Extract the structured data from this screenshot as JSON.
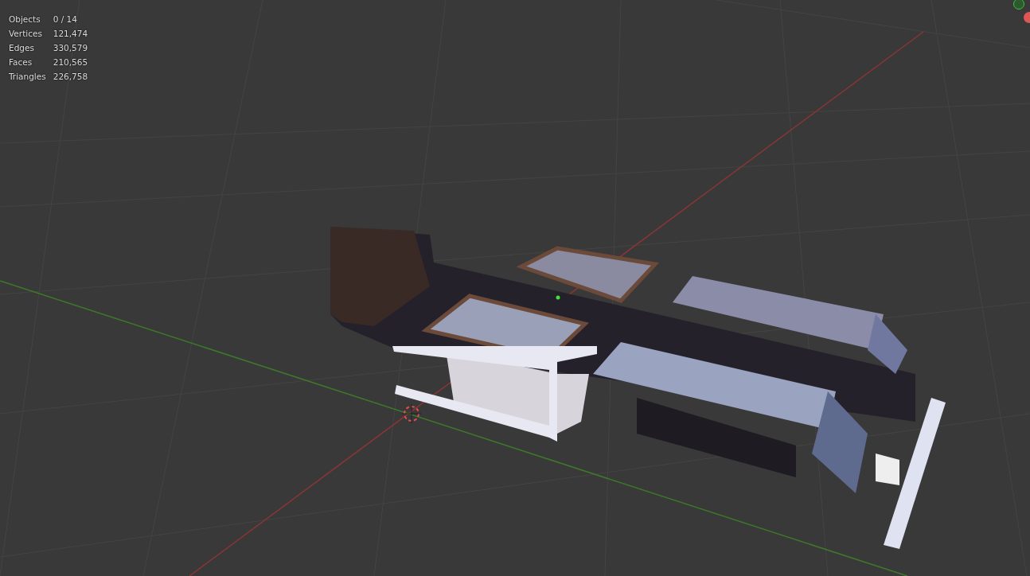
{
  "viewport": {
    "statistics": [
      {
        "label": "Objects",
        "value": "0 / 14"
      },
      {
        "label": "Vertices",
        "value": "121,474"
      },
      {
        "label": "Edges",
        "value": "330,579"
      },
      {
        "label": "Faces",
        "value": "210,565"
      },
      {
        "label": "Triangles",
        "value": "226,758"
      }
    ]
  }
}
